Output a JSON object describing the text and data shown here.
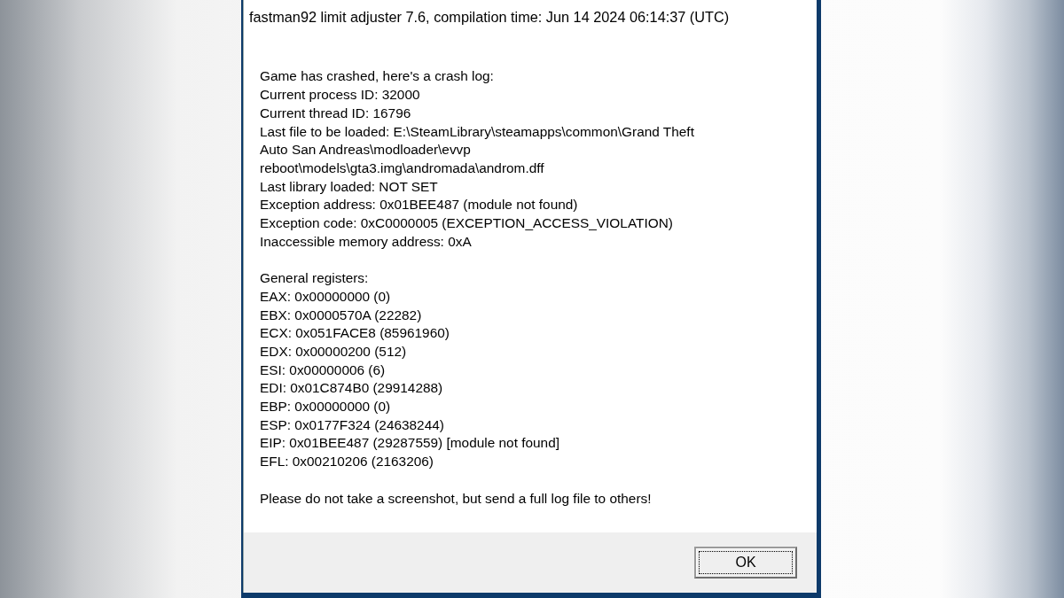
{
  "window": {
    "title": "fastman92 limit adjuster 7.6, compilation time: Jun 14 2024 06:14:37 (UTC)"
  },
  "message": {
    "sections": [
      [
        "Game has crashed, here's a crash log:",
        "Current process ID: 32000",
        "Current thread ID: 16796",
        "Last file to be loaded: E:\\SteamLibrary\\steamapps\\common\\Grand Theft",
        "Auto San Andreas\\modloader\\evvp",
        "reboot\\models\\gta3.img\\andromada\\androm.dff",
        "Last library loaded: NOT SET",
        "Exception address: 0x01BEE487 (module not found)",
        "Exception code: 0xC0000005 (EXCEPTION_ACCESS_VIOLATION)",
        "Inaccessible memory address: 0xA"
      ],
      [
        "General registers:",
        "EAX: 0x00000000 (0)",
        "EBX: 0x0000570A (22282)",
        "ECX: 0x051FACE8 (85961960)",
        "EDX: 0x00000200 (512)",
        "ESI: 0x00000006 (6)",
        "EDI: 0x01C874B0 (29914288)",
        "EBP: 0x00000000 (0)",
        "ESP: 0x0177F324 (24638244)",
        "EIP: 0x01BEE487 (29287559) [module not found]",
        "EFL: 0x00210206 (2163206)"
      ],
      [
        "Please do not take a screenshot, but send a full log file to others!"
      ]
    ]
  },
  "buttons": [
    {
      "label": "OK",
      "focused": true
    }
  ]
}
